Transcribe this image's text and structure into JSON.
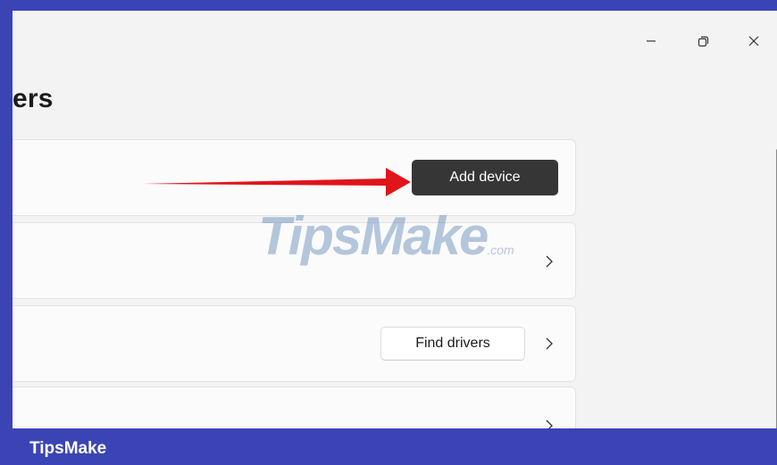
{
  "page": {
    "title": "ers"
  },
  "window_controls": {
    "minimize_icon": "minimize-icon",
    "restore_icon": "restore-icon",
    "close_icon": "close-icon"
  },
  "cards": {
    "add_device_label": "Add device",
    "find_drivers_label": "Find drivers"
  },
  "watermark": {
    "main": "TipsMake",
    "suffix": ".com"
  },
  "footer": {
    "label": "TipsMake"
  },
  "colors": {
    "frame": "#3b44b4",
    "window_bg": "#f3f3f3",
    "card_bg": "#fbfbfb",
    "primary_button": "#363636",
    "annotation_arrow": "#e0141b"
  }
}
